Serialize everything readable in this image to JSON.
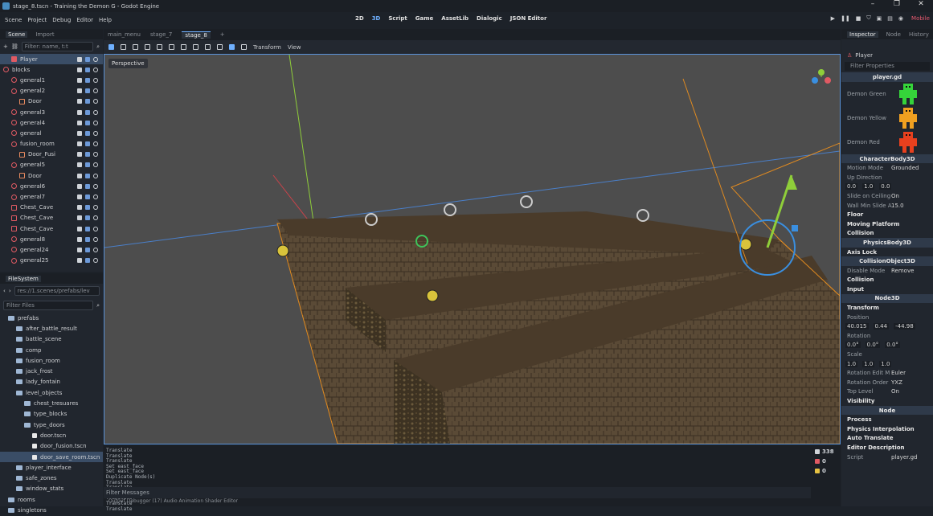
{
  "window": {
    "title": "stage_8.tscn - Training the Demon G - Godot Engine",
    "controls": [
      "–",
      "❐",
      "✕"
    ]
  },
  "menu": {
    "items": [
      "Scene",
      "Project",
      "Debug",
      "Editor",
      "Help"
    ],
    "workspaces": [
      "2D",
      "3D",
      "Script",
      "Game",
      "AssetLib",
      "Dialogic",
      "JSON Editor"
    ],
    "renderer": "Mobile"
  },
  "scene_dock": {
    "tabs": [
      "Scene",
      "Import"
    ],
    "filter_placeholder": "Filter: name, t:t",
    "nodes": [
      {
        "label": "Player",
        "kind": "player",
        "selected": true,
        "indent": 1
      },
      {
        "label": "blocks",
        "kind": "node",
        "indent": 0
      },
      {
        "label": "general1",
        "kind": "node",
        "indent": 1
      },
      {
        "label": "general2",
        "kind": "node",
        "indent": 1
      },
      {
        "label": "Door",
        "kind": "door",
        "indent": 2
      },
      {
        "label": "general3",
        "kind": "node",
        "indent": 1
      },
      {
        "label": "general4",
        "kind": "node",
        "indent": 1
      },
      {
        "label": "general",
        "kind": "node",
        "indent": 1
      },
      {
        "label": "fusion_room",
        "kind": "node",
        "indent": 1
      },
      {
        "label": "Door_Fusi",
        "kind": "door",
        "indent": 2
      },
      {
        "label": "general5",
        "kind": "node",
        "indent": 1
      },
      {
        "label": "Door",
        "kind": "door",
        "indent": 2
      },
      {
        "label": "general6",
        "kind": "node",
        "indent": 1
      },
      {
        "label": "general7",
        "kind": "node",
        "indent": 1
      },
      {
        "label": "Chest_Cave",
        "kind": "chest",
        "indent": 1
      },
      {
        "label": "Chest_Cave",
        "kind": "chest",
        "indent": 1
      },
      {
        "label": "Chest_Cave",
        "kind": "chest",
        "indent": 1
      },
      {
        "label": "general8",
        "kind": "node",
        "indent": 1
      },
      {
        "label": "general24",
        "kind": "node",
        "indent": 1
      },
      {
        "label": "general25",
        "kind": "node",
        "indent": 1
      }
    ]
  },
  "filesystem": {
    "title": "FileSystem",
    "path": "res://1.scenes/prefabs/lev",
    "filter_placeholder": "Filter Files",
    "items": [
      {
        "label": "prefabs",
        "type": "folder",
        "indent": 1
      },
      {
        "label": "after_battle_result",
        "type": "folder",
        "indent": 2
      },
      {
        "label": "battle_scene",
        "type": "folder",
        "indent": 2
      },
      {
        "label": "comp",
        "type": "folder",
        "indent": 2
      },
      {
        "label": "fusion_room",
        "type": "folder",
        "indent": 2
      },
      {
        "label": "jack_frost",
        "type": "folder",
        "indent": 2
      },
      {
        "label": "lady_fontain",
        "type": "folder",
        "indent": 2
      },
      {
        "label": "level_objects",
        "type": "folder",
        "indent": 2
      },
      {
        "label": "chest_tresuares",
        "type": "folder",
        "indent": 3
      },
      {
        "label": "type_blocks",
        "type": "folder",
        "indent": 3
      },
      {
        "label": "type_doors",
        "type": "folder",
        "indent": 3
      },
      {
        "label": "door.tscn",
        "type": "file",
        "indent": 4
      },
      {
        "label": "door_fusion.tscn",
        "type": "file",
        "indent": 4
      },
      {
        "label": "door_save_room.tscn",
        "type": "file",
        "indent": 4,
        "selected": true
      },
      {
        "label": "player_interface",
        "type": "folder",
        "indent": 2
      },
      {
        "label": "safe_zones",
        "type": "folder",
        "indent": 2
      },
      {
        "label": "window_stats",
        "type": "folder",
        "indent": 2
      },
      {
        "label": "rooms",
        "type": "folder",
        "indent": 1
      },
      {
        "label": "singletons",
        "type": "folder",
        "indent": 1
      }
    ]
  },
  "editor": {
    "tabs": [
      "main_menu",
      "stage_7",
      "stage_8"
    ],
    "active_tab": "stage_8",
    "toolbar": [
      "Transform",
      "View"
    ],
    "viewport_label": "Perspective"
  },
  "output": {
    "lines": [
      "Translate",
      "Translate",
      "Translate",
      "Set east_face",
      "Set east_face",
      "Duplicate Node(s)",
      "Translate",
      "Translate",
      "Translate",
      "Translate",
      "Translate",
      "Translate"
    ],
    "filter_placeholder": "Filter Messages",
    "counts": {
      "messages": "338",
      "errors": "0",
      "warnings": "0",
      "info": "71"
    },
    "bottom_tabs": "Output   Debugger (17)   Audio   Animation   Shader Editor"
  },
  "inspector": {
    "tabs": [
      "Inspector",
      "Node",
      "History"
    ],
    "node_name": "Player",
    "filter_placeholder": "Filter Properties",
    "script_header": "player.gd",
    "demons": [
      "Demon Green",
      "Demon Yellow",
      "Demon Red"
    ],
    "character_body": "CharacterBody3D",
    "motion_mode": {
      "label": "Motion Mode",
      "value": "Grounded"
    },
    "up_direction": {
      "label": "Up Direction",
      "x": "0.0",
      "y": "1.0",
      "z": "0.0"
    },
    "slide_on_ceiling": {
      "label": "Slide on Ceiling",
      "value": "On"
    },
    "wall_min_slide": {
      "label": "Wall Min Slide A",
      "value": "15.0"
    },
    "groups": [
      "Floor",
      "Moving Platform",
      "Collision"
    ],
    "physics_body": "PhysicsBody3D",
    "axis_lock": "Axis Lock",
    "collision_object": "CollisionObject3D",
    "disable_mode": {
      "label": "Disable Mode",
      "value": "Remove"
    },
    "groups2": [
      "Collision",
      "Input"
    ],
    "node3d": "Node3D",
    "transform": "Transform",
    "position": {
      "label": "Position",
      "x": "40.015",
      "y": "0.44",
      "z": "-44.98"
    },
    "rotation": {
      "label": "Rotation",
      "x": "0.0°",
      "y": "0.0°",
      "z": "0.0°"
    },
    "scale": {
      "label": "Scale",
      "x": "1.0",
      "y": "1.0",
      "z": "1.0"
    },
    "rotation_edit": {
      "label": "Rotation Edit M",
      "value": "Euler"
    },
    "rotation_order": {
      "label": "Rotation Order",
      "value": "YXZ"
    },
    "top_level": {
      "label": "Top Level",
      "value": "On"
    },
    "visibility": "Visibility",
    "node": "Node",
    "groups3": [
      "Process",
      "Physics Interpolation",
      "Auto Translate",
      "Editor Description"
    ],
    "script": {
      "label": "Script",
      "value": "player.gd"
    }
  },
  "colors": {
    "accent": "#6fb0ff",
    "node_red": "#e05a63",
    "selection": "#3a4d66"
  }
}
